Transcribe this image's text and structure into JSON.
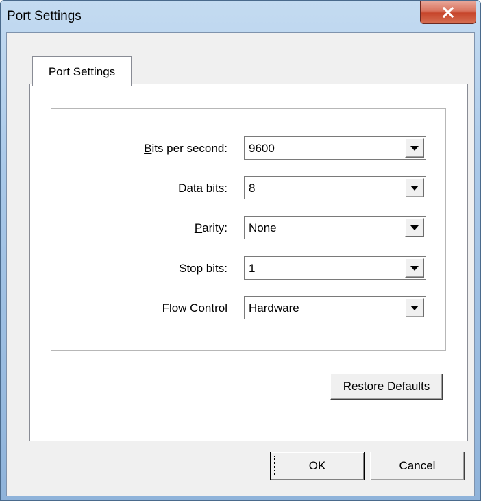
{
  "window": {
    "title": "Port Settings",
    "close_icon": "close-icon"
  },
  "tab": {
    "label": "Port Settings"
  },
  "fields": [
    {
      "label_accel": "B",
      "label_rest": "its per second:",
      "value": "9600"
    },
    {
      "label_accel": "D",
      "label_rest": "ata bits:",
      "value": "8"
    },
    {
      "label_accel": "P",
      "label_rest": "arity:",
      "value": "None"
    },
    {
      "label_accel": "S",
      "label_rest": "top bits:",
      "value": "1"
    },
    {
      "label_accel": "F",
      "label_rest": "low Control",
      "value": "Hardware"
    }
  ],
  "buttons": {
    "restore_accel": "R",
    "restore_rest": "estore Defaults",
    "ok": "OK",
    "cancel": "Cancel"
  },
  "colors": {
    "titlebar": "#a9c8e8",
    "close_button": "#c6452b",
    "dialog_face": "#f0f0f0"
  }
}
